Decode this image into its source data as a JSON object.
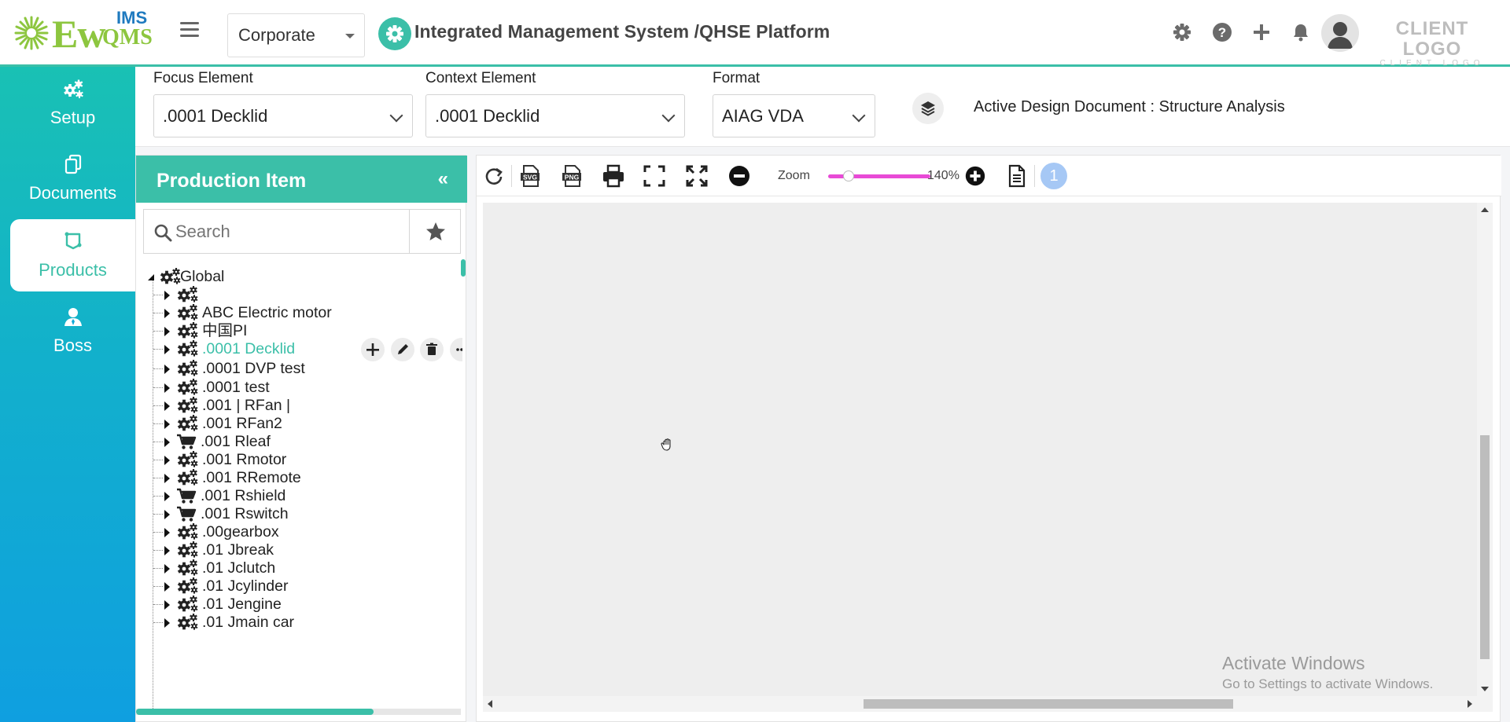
{
  "header": {
    "logo": {
      "ew": "Ew",
      "ims": "IMS",
      "qms": "QMS"
    },
    "company_select": "Corporate",
    "platform_title": "Integrated Management System /QHSE Platform",
    "icons": [
      "gear-icon",
      "help-icon",
      "plus-icon",
      "bell-icon",
      "avatar"
    ],
    "client_logo": {
      "main": "CLIENT LOGO",
      "sub": "CLIENT LOGO"
    }
  },
  "nav": {
    "items": [
      {
        "label": "Setup",
        "icon": "gears-icon",
        "active": false
      },
      {
        "label": "Documents",
        "icon": "documents-icon",
        "active": false
      },
      {
        "label": "Products",
        "icon": "products-icon",
        "active": true
      },
      {
        "label": "Boss",
        "icon": "user-icon",
        "active": false
      }
    ]
  },
  "filters": {
    "focus": {
      "label": "Focus Element",
      "value": ".0001 Decklid"
    },
    "context": {
      "label": "Context Element",
      "value": ".0001 Decklid"
    },
    "format": {
      "label": "Format",
      "value": "AIAG VDA"
    },
    "active_document": "Active Design Document : Structure Analysis"
  },
  "panel": {
    "title": "Production Item",
    "collapse_label": "«",
    "search_placeholder": "Search",
    "tree": {
      "root": "Global",
      "items": [
        {
          "label": "",
          "icon": "gears-icon"
        },
        {
          "label": "ABC Electric motor",
          "icon": "gears-icon"
        },
        {
          "label": "中国PI",
          "icon": "gears-icon"
        },
        {
          "label": ".0001 Decklid",
          "icon": "gears-icon",
          "selected": true
        },
        {
          "label": ".0001 DVP test",
          "icon": "gears-icon"
        },
        {
          "label": ".0001 test",
          "icon": "gears-icon"
        },
        {
          "label": ".001 | RFan |",
          "icon": "gears-icon"
        },
        {
          "label": ".001 RFan2",
          "icon": "gears-icon"
        },
        {
          "label": ".001 Rleaf",
          "icon": "cart-icon"
        },
        {
          "label": ".001 Rmotor",
          "icon": "gears-icon"
        },
        {
          "label": ".001 RRemote",
          "icon": "gears-icon"
        },
        {
          "label": ".001 Rshield",
          "icon": "cart-icon"
        },
        {
          "label": ".001 Rswitch",
          "icon": "cart-icon"
        },
        {
          "label": ".00gearbox",
          "icon": "gears-icon"
        },
        {
          "label": ".01 Jbreak",
          "icon": "gears-icon"
        },
        {
          "label": ".01 Jclutch",
          "icon": "gears-icon"
        },
        {
          "label": ".01 Jcylinder",
          "icon": "gears-icon"
        },
        {
          "label": ".01 Jengine",
          "icon": "gears-icon"
        },
        {
          "label": ".01 Jmain car",
          "icon": "gears-icon"
        }
      ],
      "row_actions": [
        "add-icon",
        "edit-icon",
        "delete-icon",
        "more-icon"
      ]
    }
  },
  "diagram": {
    "toolbar": {
      "zoom_label": "Zoom",
      "zoom_value": "140%",
      "zoom_fraction": 0.2,
      "page_number": "1"
    }
  },
  "watermark": {
    "line1": "Activate Windows",
    "line2": "Go to Settings to activate Windows."
  },
  "colors": {
    "accent": "#3bbfa8",
    "zoom_slider": "#e84ad6",
    "page_badge": "#a6c8f5"
  }
}
